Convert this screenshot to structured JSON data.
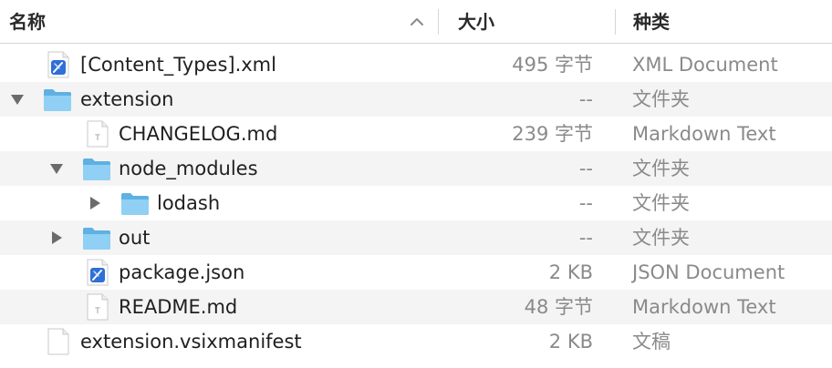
{
  "header": {
    "name_label": "名称",
    "size_label": "大小",
    "kind_label": "种类",
    "sort_direction": "ascending"
  },
  "rows": [
    {
      "name": "[Content_Types].xml",
      "size": "495 字节",
      "kind": "XML Document",
      "icon": "xml-file-icon",
      "disclosure": "none"
    },
    {
      "name": "extension",
      "size": "--",
      "kind": "文件夹",
      "icon": "folder-icon",
      "disclosure": "expanded"
    },
    {
      "name": "CHANGELOG.md",
      "size": "239 字节",
      "kind": "Markdown Text",
      "icon": "text-file-icon",
      "disclosure": "none"
    },
    {
      "name": "node_modules",
      "size": "--",
      "kind": "文件夹",
      "icon": "folder-icon",
      "disclosure": "expanded"
    },
    {
      "name": "lodash",
      "size": "--",
      "kind": "文件夹",
      "icon": "folder-icon",
      "disclosure": "collapsed"
    },
    {
      "name": "out",
      "size": "--",
      "kind": "文件夹",
      "icon": "folder-icon",
      "disclosure": "collapsed"
    },
    {
      "name": "package.json",
      "size": "2 KB",
      "kind": "JSON Document",
      "icon": "json-file-icon",
      "disclosure": "none"
    },
    {
      "name": "README.md",
      "size": "48 字节",
      "kind": "Markdown Text",
      "icon": "text-file-icon",
      "disclosure": "none"
    },
    {
      "name": "extension.vsixmanifest",
      "size": "2 KB",
      "kind": "文稿",
      "icon": "document-file-icon",
      "disclosure": "none"
    }
  ],
  "colors": {
    "folder": "#7cc3ec",
    "alt_row": "#f4f4f4",
    "secondary_text": "#8a8a8a"
  }
}
